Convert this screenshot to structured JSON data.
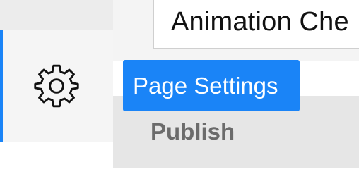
{
  "title_field": {
    "value": "Animation Che"
  },
  "nav": {
    "settings_icon": "gear-icon",
    "active_color": "#1a84f7"
  },
  "menu": {
    "page_settings_label": "Page Settings",
    "publish_label": "Publish"
  },
  "colors": {
    "accent": "#1a84f7",
    "muted_text": "#6b6b6b"
  }
}
